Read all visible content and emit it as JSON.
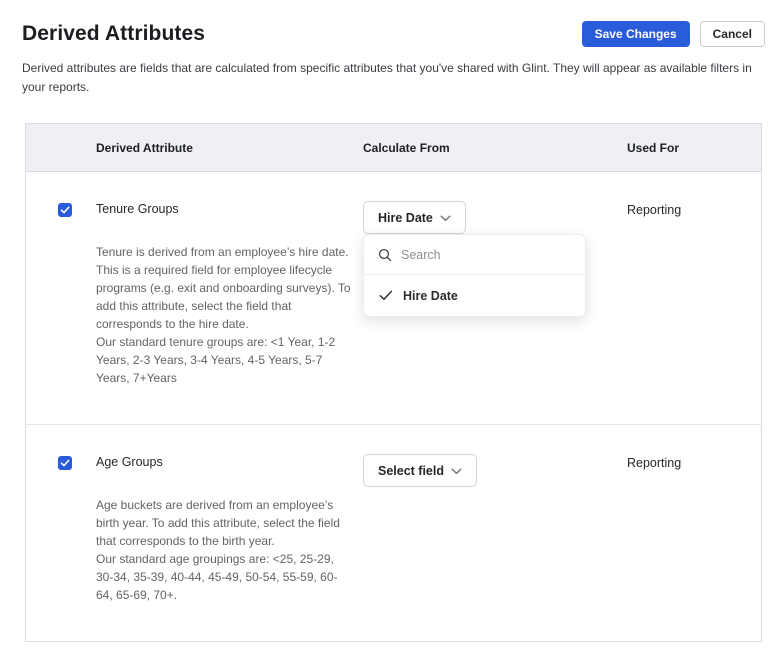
{
  "page": {
    "title": "Derived Attributes",
    "description": "Derived attributes are fields that are calculated from specific attributes that you've shared with Glint. They will appear as available filters in your reports."
  },
  "actions": {
    "save_label": "Save Changes",
    "cancel_label": "Cancel"
  },
  "table": {
    "headers": [
      "Derived Attribute",
      "Calculate From",
      "Used For"
    ],
    "rows": [
      {
        "checked": true,
        "name": "Tenure Groups",
        "description": "Tenure is derived from an employee’s hire date. This is a required field for employee lifecycle programs (e.g. exit and onboarding surveys). To add this attribute, select the field that corresponds to the hire date.",
        "description2": "Our standard tenure groups are: <1 Year, 1-2 Years, 2-3 Years, 3-4 Years, 4-5 Years, 5-7 Years, 7+Years",
        "dropdown_label": "Hire Date",
        "used_for": "Reporting"
      },
      {
        "checked": true,
        "name": "Age Groups",
        "description": "Age buckets are derived from an employee’s birth year. To add this attribute, select the field that corresponds to the birth year.",
        "description2": "Our standard age groupings are: <25, 25-29, 30-34, 35-39, 40-44, 45-49, 50-54, 55-59, 60-64, 65-69, 70+.",
        "dropdown_label": "Select field",
        "used_for": "Reporting"
      }
    ]
  },
  "calculate_from_menu": {
    "search_placeholder": "Search",
    "options": [
      {
        "label": "Hire Date",
        "selected": true
      }
    ]
  },
  "colors": {
    "accent_blue": "#2a5bd8",
    "header_bg": "#eef0f3",
    "table_border": "#d8dbdf"
  }
}
